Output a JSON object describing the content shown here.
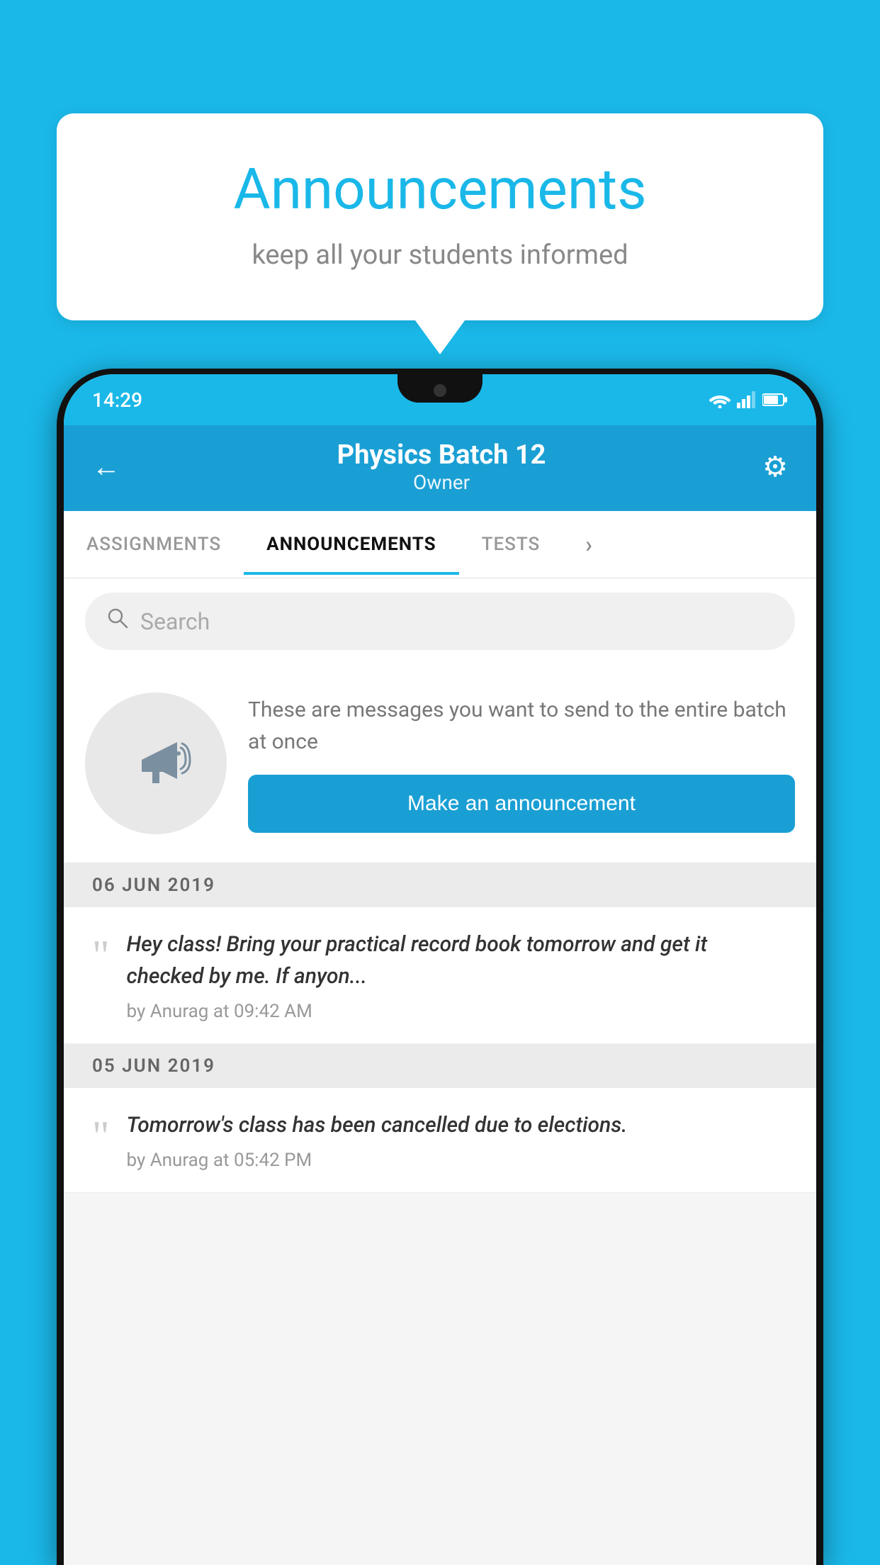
{
  "background_color": "#1ab8e8",
  "speech_bubble": {
    "title": "Announcements",
    "subtitle": "keep all your students informed"
  },
  "status_bar": {
    "time": "14:29",
    "icons": [
      "wifi",
      "signal",
      "battery"
    ]
  },
  "app_header": {
    "back_label": "←",
    "title": "Physics Batch 12",
    "subtitle": "Owner",
    "gear_label": "⚙"
  },
  "tabs": [
    {
      "label": "ASSIGNMENTS",
      "active": false
    },
    {
      "label": "ANNOUNCEMENTS",
      "active": true
    },
    {
      "label": "TESTS",
      "active": false
    },
    {
      "label": "›",
      "active": false
    }
  ],
  "search": {
    "placeholder": "Search",
    "icon": "🔍"
  },
  "promo": {
    "description": "These are messages you want to send to the entire batch at once",
    "button_label": "Make an announcement"
  },
  "date_sections": [
    {
      "date": "06  JUN  2019",
      "announcements": [
        {
          "text": "Hey class! Bring your practical record book tomorrow and get it checked by me. If anyon...",
          "meta": "by Anurag at 09:42 AM"
        }
      ]
    },
    {
      "date": "05  JUN  2019",
      "announcements": [
        {
          "text": "Tomorrow's class has been cancelled due to elections.",
          "meta": "by Anurag at 05:42 PM"
        }
      ]
    }
  ]
}
